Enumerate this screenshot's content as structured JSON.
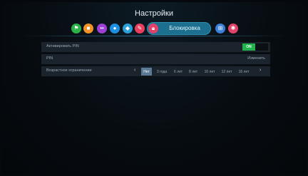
{
  "header": {
    "title": "Настройки"
  },
  "tabs": {
    "icons": [
      {
        "name": "flag-icon",
        "color": "#2bb34a",
        "glyph": "⚑"
      },
      {
        "name": "film-icon",
        "color": "#f2932a",
        "glyph": "■"
      },
      {
        "name": "dots-icon",
        "color": "#9b3fd6",
        "glyph": "••"
      },
      {
        "name": "globe-icon",
        "color": "#1e8fe0",
        "glyph": "●"
      },
      {
        "name": "shield-icon",
        "color": "#2a9fd8",
        "glyph": "◆"
      },
      {
        "name": "pencil-icon",
        "color": "#e83f5e",
        "glyph": "✎"
      },
      {
        "name": "network-icon",
        "color": "#3a7fd8",
        "glyph": "⊞"
      },
      {
        "name": "gear-icon",
        "color": "#e0436a",
        "glyph": "✱"
      }
    ],
    "active_label": "Блокировка",
    "active_icon": "lock-icon"
  },
  "settings": {
    "pin_enable": {
      "label": "Активировать PIN",
      "toggle": "ON"
    },
    "pin": {
      "label": "PIN",
      "action": "Изменить"
    },
    "age": {
      "label": "Возрастное ограничение",
      "options": [
        "Нет",
        "3 года",
        "6 лет",
        "8 лет",
        "10 лет",
        "12 лет",
        "16 лет"
      ],
      "selected": "Нет"
    }
  },
  "colors": {
    "accent": "#1c6f8f",
    "on": "#22b14c",
    "selected": "#5a7a95"
  }
}
